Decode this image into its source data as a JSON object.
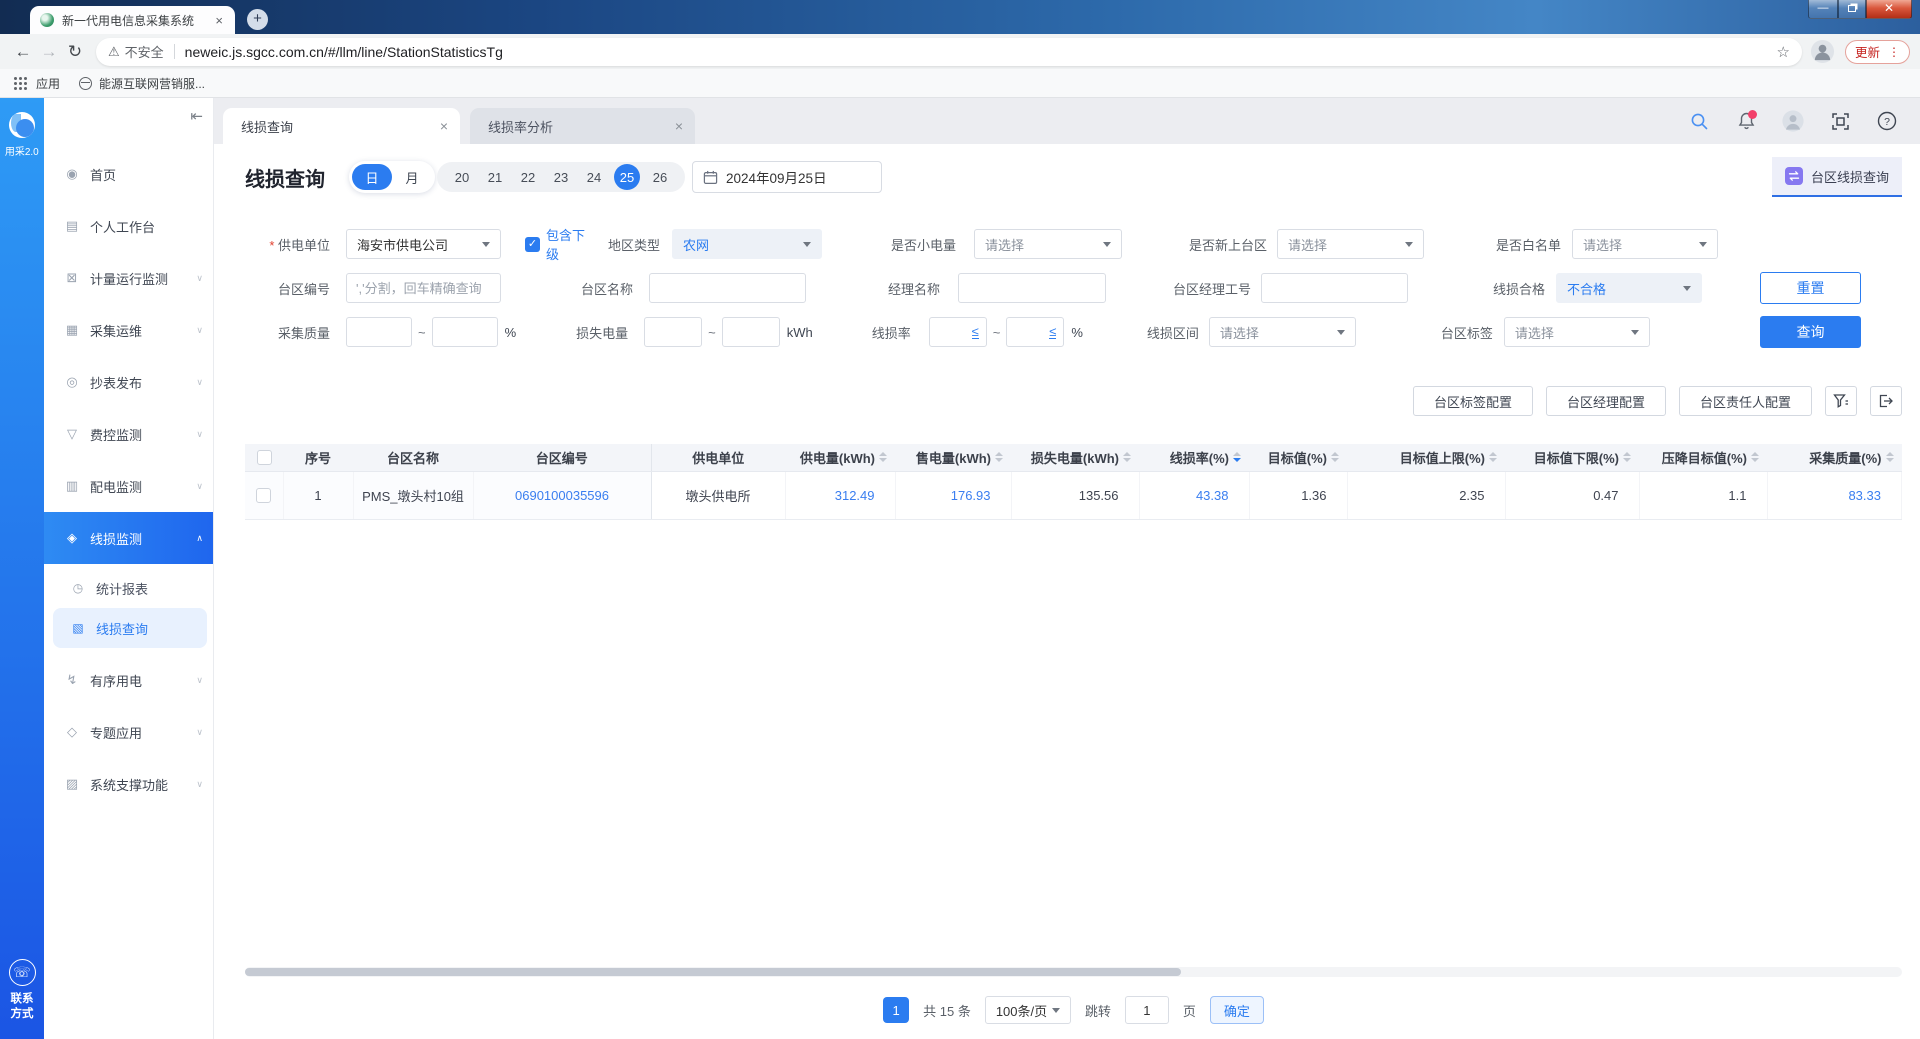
{
  "browser": {
    "tab_title": "新一代用电信息采集系统",
    "security_label": "不安全",
    "url": "neweic.js.sgcc.com.cn/#/llm/line/StationStatisticsTg",
    "update_label": "更新",
    "bookmarks_apps_label": "应用",
    "bookmark_item": "能源互联网营销服..."
  },
  "rail": {
    "logo_label": "用采2.0",
    "contact_line1": "联系",
    "contact_line2": "方式"
  },
  "sidebar": {
    "items": [
      {
        "label": "首页",
        "icon": "◉"
      },
      {
        "label": "个人工作台",
        "icon": "▤"
      },
      {
        "label": "计量运行监测",
        "icon": "⊠"
      },
      {
        "label": "采集运维",
        "icon": "▦"
      },
      {
        "label": "抄表发布",
        "icon": "◎"
      },
      {
        "label": "费控监测",
        "icon": "▽"
      },
      {
        "label": "配电监测",
        "icon": "▥"
      },
      {
        "label": "线损监测",
        "icon": "◈"
      },
      {
        "label": "统计报表",
        "icon": "◷"
      },
      {
        "label": "线损查询",
        "icon": "▧"
      },
      {
        "label": "有序用电",
        "icon": "↯"
      },
      {
        "label": "专题应用",
        "icon": "◇"
      },
      {
        "label": "系统支撑功能",
        "icon": "▨"
      }
    ]
  },
  "workspace_tabs": [
    {
      "label": "线损查询"
    },
    {
      "label": "线损率分析"
    }
  ],
  "page": {
    "title": "线损查询",
    "mode_day": "日",
    "mode_month": "月",
    "dates": [
      "20",
      "21",
      "22",
      "23",
      "24",
      "25",
      "26"
    ],
    "active_date": "25",
    "date_value": "2024年09月25日",
    "context_tab": "台区线损查询"
  },
  "filters": {
    "power_unit": {
      "label": "供电单位",
      "value": "海安市供电公司"
    },
    "include_sub": {
      "label": "包含下级",
      "checked": true
    },
    "region_type": {
      "label": "地区类型",
      "value": "农网"
    },
    "small_power": {
      "label": "是否小电量",
      "value": "请选择"
    },
    "new_station": {
      "label": "是否新上台区",
      "value": "请选择"
    },
    "whitelist": {
      "label": "是否白名单",
      "value": "请选择"
    },
    "station_code": {
      "label": "台区编号",
      "placeholder": "','分割，回车精确查询"
    },
    "station_name": {
      "label": "台区名称"
    },
    "manager_name": {
      "label": "经理名称"
    },
    "manager_no": {
      "label": "台区经理工号"
    },
    "loss_qualified": {
      "label": "线损合格",
      "value": "不合格"
    },
    "collect_quality": {
      "label": "采集质量",
      "unit": "%"
    },
    "loss_energy": {
      "label": "损失电量",
      "unit": "kWh"
    },
    "loss_rate": {
      "label": "线损率",
      "lte": "≤",
      "unit": "%"
    },
    "loss_interval": {
      "label": "线损区间",
      "value": "请选择"
    },
    "station_tag": {
      "label": "台区标签",
      "value": "请选择"
    },
    "tilde": "~",
    "reset_label": "重置",
    "query_label": "查询"
  },
  "actions": [
    "台区标签配置",
    "台区经理配置",
    "台区责任人配置"
  ],
  "table": {
    "columns": [
      {
        "label": "序号",
        "sortable": false
      },
      {
        "label": "台区名称",
        "sortable": false
      },
      {
        "label": "台区编号",
        "sortable": false
      },
      {
        "label": "供电单位",
        "sortable": false
      },
      {
        "label": "供电量(kWh)",
        "sortable": true
      },
      {
        "label": "售电量(kWh)",
        "sortable": true
      },
      {
        "label": "损失电量(kWh)",
        "sortable": true
      },
      {
        "label": "线损率(%)",
        "sortable": true,
        "sorted": "desc"
      },
      {
        "label": "目标值(%)",
        "sortable": true
      },
      {
        "label": "目标值上限(%)",
        "sortable": true
      },
      {
        "label": "目标值下限(%)",
        "sortable": true
      },
      {
        "label": "压降目标值(%)",
        "sortable": true
      },
      {
        "label": "采集质量(%)",
        "sortable": true
      }
    ],
    "row": {
      "seq": "1",
      "station_name": "PMS_墩头村10组",
      "station_code": "0690100035596",
      "supply_unit": "墩头供电所",
      "supply_energy": "312.49",
      "sold_energy": "176.93",
      "loss_energy": "135.56",
      "loss_rate": "43.38",
      "target": "1.36",
      "target_upper": "2.35",
      "target_lower": "0.47",
      "reduction_target": "1.1",
      "collect_quality": "83.33"
    }
  },
  "pagination": {
    "current_page": "1",
    "total": "共 15 条",
    "page_size": "100条/页",
    "jump": "跳转",
    "jump_value": "1",
    "unit_page": "页",
    "confirm": "确定"
  },
  "icons": {
    "close": "×",
    "caret_down": "∨",
    "caret_up": "∧",
    "check": "✓",
    "star": "☆",
    "warning": "⚠",
    "reload": "↻",
    "back": "←",
    "forward": "→",
    "plus": "+",
    "minimize": "—",
    "phone": "☏",
    "collapse": "⇤",
    "more": "⋮",
    "help": "?",
    "calendar-icon": "svg",
    "search-icon": "svg-magnifier",
    "bell-icon": "svg-bell",
    "user-icon": "svg-avatar",
    "fullscreen-icon": "svg-brackets",
    "filter-icon": "svg-funnel",
    "export-icon": "svg-export",
    "swap-icon": "svg-swap"
  },
  "colors": {
    "accent": "#2b7cf0",
    "link": "#3a7ef0",
    "danger": "#c5221f",
    "sort_active": "#2b7cf0"
  }
}
